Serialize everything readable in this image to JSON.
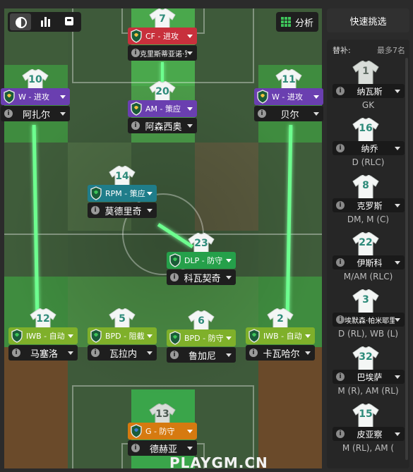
{
  "toolbar": {
    "analysis_label": "分析",
    "quick_pick_label": "快速挑选"
  },
  "colors": {
    "link_line": "#6dff8f",
    "role_attack": "#6a3fb0",
    "role_striker": "#c8303c",
    "role_support_teal": "#1f7d8a",
    "role_defend_green": "#25a04a",
    "role_auto_lime": "#7fb02a",
    "role_gk_orange": "#d67a10"
  },
  "players": [
    {
      "number": "7",
      "role": "CF - 进攻",
      "name": "克里斯蒂亚诺·罗纳尔多",
      "role_color": "red"
    },
    {
      "number": "10",
      "role": "W - 进攻",
      "name": "阿扎尔",
      "role_color": "purple"
    },
    {
      "number": "20",
      "role": "AM - 策应",
      "name": "阿森西奥",
      "role_color": "purple"
    },
    {
      "number": "11",
      "role": "W - 进攻",
      "name": "贝尔",
      "role_color": "purple"
    },
    {
      "number": "14",
      "role": "RPM - 策应",
      "name": "莫德里奇",
      "role_color": "teal"
    },
    {
      "number": "23",
      "role": "DLP - 防守",
      "name": "科瓦契奇",
      "role_color": "green"
    },
    {
      "number": "12",
      "role": "IWB - 自动",
      "name": "马塞洛",
      "role_color": "lime"
    },
    {
      "number": "5",
      "role": "BPD - 阻截",
      "name": "瓦拉内",
      "role_color": "lime"
    },
    {
      "number": "6",
      "role": "BPD - 防守",
      "name": "鲁加尼",
      "role_color": "lime"
    },
    {
      "number": "2",
      "role": "IWB - 自动",
      "name": "卡瓦哈尔",
      "role_color": "lime"
    },
    {
      "number": "13",
      "role": "G - 防守",
      "name": "德赫亚",
      "role_color": "orange"
    }
  ],
  "subs": {
    "title": "替补:",
    "max_label": "最多7名",
    "items": [
      {
        "number": "1",
        "name": "纳瓦斯",
        "pos": "GK"
      },
      {
        "number": "16",
        "name": "纳乔",
        "pos": "D (RLC)"
      },
      {
        "number": "8",
        "name": "克罗斯",
        "pos": "DM, M (C)"
      },
      {
        "number": "22",
        "name": "伊斯科",
        "pos": "M/AM (RLC)"
      },
      {
        "number": "3",
        "name": "埃默森·帕米耶里",
        "pos": "D (RL), WB (L)"
      },
      {
        "number": "32",
        "name": "巴埃萨",
        "pos": "M (R), AM (RL)"
      },
      {
        "number": "15",
        "name": "皮亚察",
        "pos": "M (RL), AM ("
      }
    ]
  },
  "watermark": "PLAYGM.CN"
}
